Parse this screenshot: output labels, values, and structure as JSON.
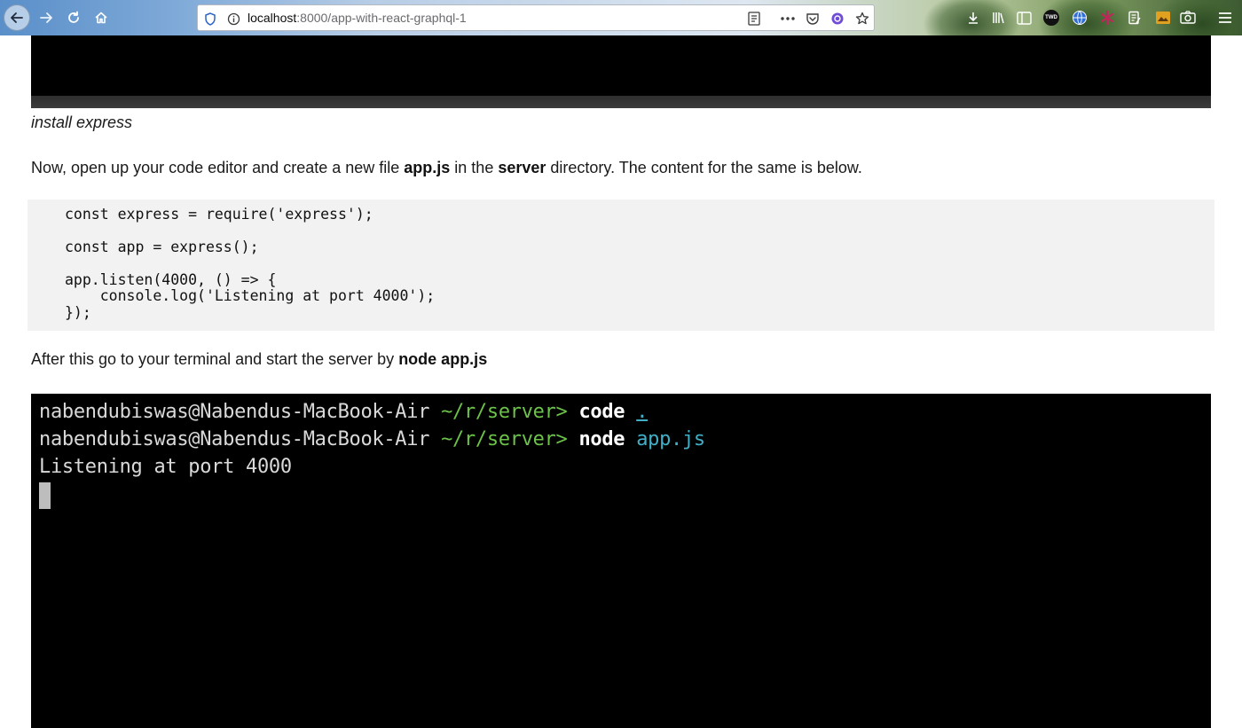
{
  "browser": {
    "url_host": "localhost",
    "url_rest": ":8000/app-with-react-graphql-1",
    "icons": {
      "back": "back-arrow-icon",
      "forward": "forward-arrow-icon",
      "reload": "reload-icon",
      "home": "home-icon",
      "tracking": "shield-icon",
      "info": "info-icon",
      "reader": "reader-view-icon",
      "more": "more-actions-icon",
      "pocket": "pocket-icon",
      "ext": "extension-icon",
      "bookmark": "star-icon"
    },
    "extension_badge": "TWD"
  },
  "article": {
    "caption": "install express",
    "para1": {
      "before": "Now, open up your code editor and create a new file ",
      "file": "app.js",
      "middle": " in the ",
      "dir": "server",
      "after": " directory. The content for the same is below."
    },
    "code_lines": [
      "const express = require('express');",
      "const app = express();",
      "app.listen(4000, () => {",
      "    console.log('Listening at port 4000');",
      "});"
    ],
    "para2": {
      "before": "After this go to your terminal and start the server by ",
      "cmd": "node app.js"
    }
  },
  "terminal": {
    "prompt_user": "nabendubiswas@Nabendus-MacBook-Air",
    "prompt_path": "~/r/server>",
    "line1_cmd": "code",
    "line1_arg": ".",
    "line2_cmd": "node",
    "line2_arg": "app.js",
    "output": "Listening at port 4000"
  },
  "colors": {
    "terminal_bg": "#000000",
    "code_bg": "#f2f2f2",
    "path_green": "#6cc24a",
    "arg_cyan": "#3fb0c8"
  }
}
